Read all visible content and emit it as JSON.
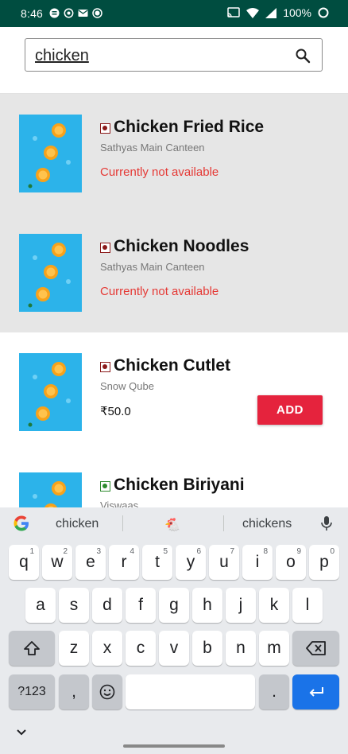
{
  "status_bar": {
    "time": "8:46",
    "battery": "100%"
  },
  "search": {
    "value": "chicken"
  },
  "results": [
    {
      "name": "Chicken Fried Rice",
      "shop": "Sathyas Main Canteen",
      "status": "Currently not available",
      "available": false,
      "diet": "non-veg"
    },
    {
      "name": "Chicken Noodles",
      "shop": "Sathyas Main Canteen",
      "status": "Currently not available",
      "available": false,
      "diet": "non-veg"
    },
    {
      "name": "Chicken Cutlet",
      "shop": "Snow Qube",
      "price": "₹50.0",
      "add_label": "ADD",
      "available": true,
      "diet": "non-veg"
    },
    {
      "name": "Chicken Biriyani",
      "shop": "Viswaas",
      "available": true,
      "diet": "veg"
    }
  ],
  "keyboard": {
    "suggestions": [
      "chicken",
      "🐔",
      "chickens"
    ],
    "row1": [
      [
        "q",
        "1"
      ],
      [
        "w",
        "2"
      ],
      [
        "e",
        "3"
      ],
      [
        "r",
        "4"
      ],
      [
        "t",
        "5"
      ],
      [
        "y",
        "6"
      ],
      [
        "u",
        "7"
      ],
      [
        "i",
        "8"
      ],
      [
        "o",
        "9"
      ],
      [
        "p",
        "0"
      ]
    ],
    "row2": [
      "a",
      "s",
      "d",
      "f",
      "g",
      "h",
      "j",
      "k",
      "l"
    ],
    "row3": [
      "z",
      "x",
      "c",
      "v",
      "b",
      "n",
      "m"
    ],
    "symbols_label": "?123",
    "comma": ",",
    "period": "."
  },
  "colors": {
    "status_bar": "#004d40",
    "unavailable_text": "#e53935",
    "add_button": "#e5233d",
    "non_veg_mark": "#8b1a1a",
    "veg_mark": "#2e8b2e",
    "enter_key": "#1a73e8"
  },
  "icons": [
    "cast-icon",
    "wifi-icon",
    "signal-icon",
    "battery-icon",
    "search-icon",
    "google-icon",
    "mic-icon",
    "shift-icon",
    "backspace-icon",
    "emoji-icon",
    "enter-icon",
    "chevron-down-icon"
  ]
}
